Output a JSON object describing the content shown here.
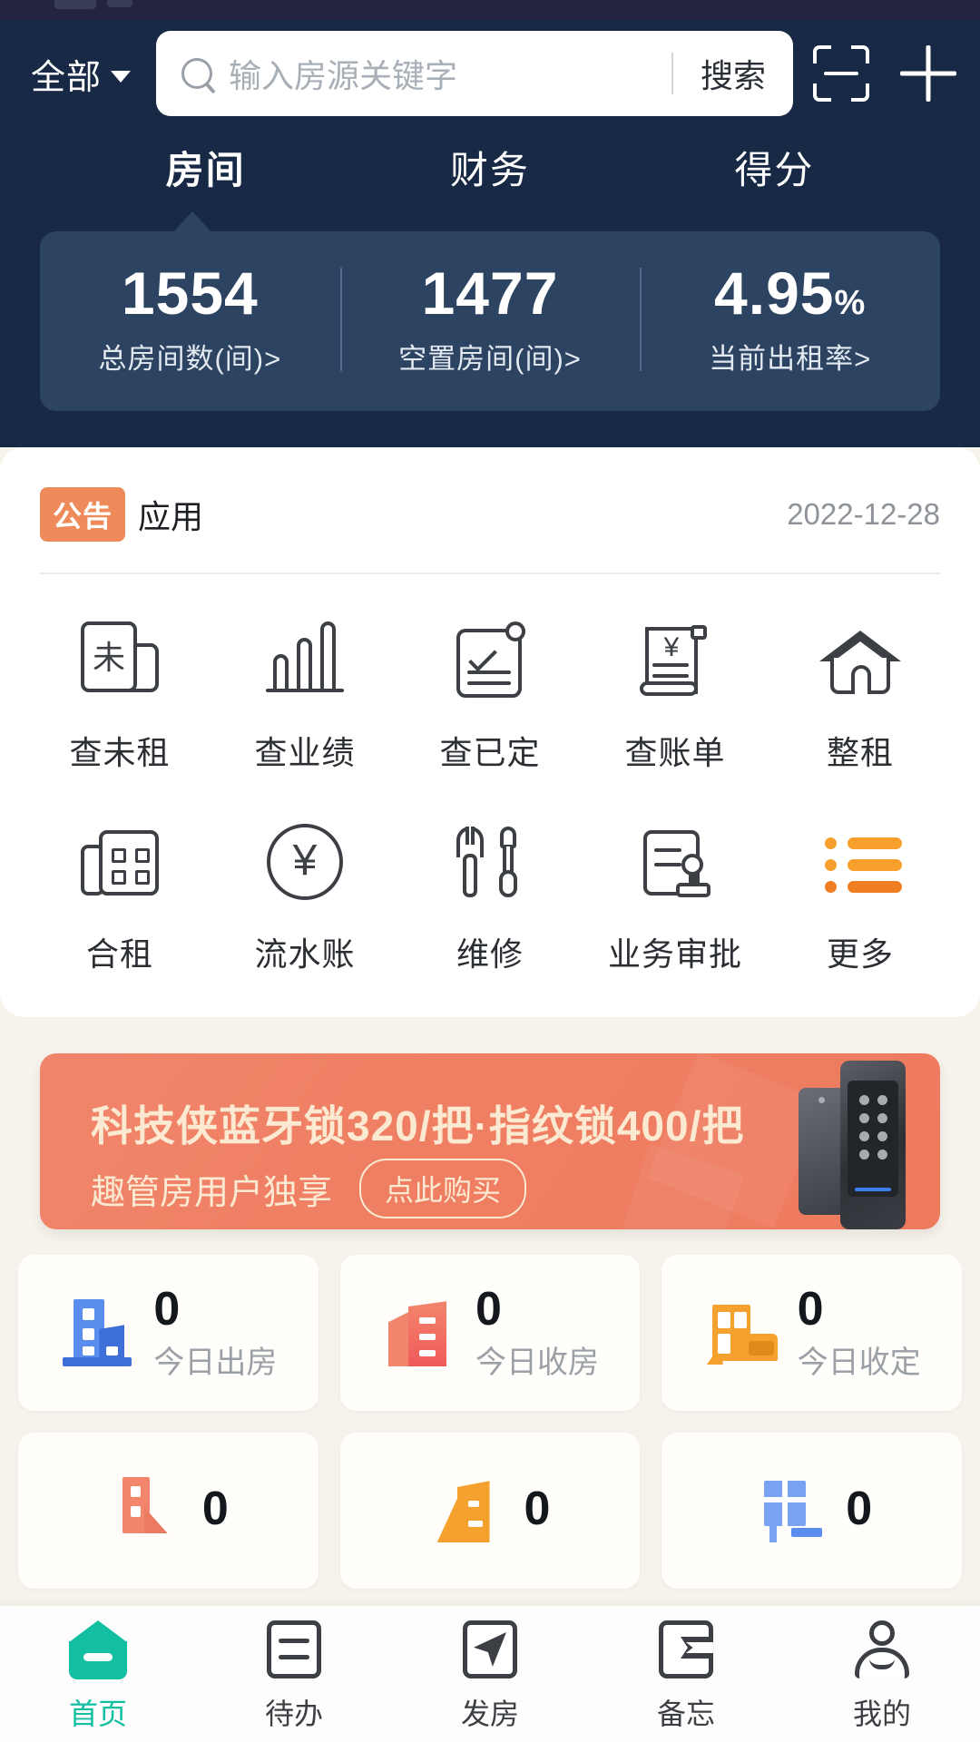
{
  "header": {
    "filter_label": "全部",
    "search_placeholder": "输入房源关键字",
    "search_value": "",
    "search_button": "搜索",
    "scan_icon": "scan-icon",
    "add_icon": "plus-icon"
  },
  "tabs": [
    {
      "label": "房间",
      "active": true
    },
    {
      "label": "财务",
      "active": false
    },
    {
      "label": "得分",
      "active": false
    }
  ],
  "stats": [
    {
      "value": "1554",
      "suffix": "",
      "label": "总房间数(间)>"
    },
    {
      "value": "1477",
      "suffix": "",
      "label": "空置房间(间)>"
    },
    {
      "value": "4.95",
      "suffix": "%",
      "label": "当前出租率>"
    }
  ],
  "notice": {
    "badge": "公告",
    "text": "应用",
    "date": "2022-12-28"
  },
  "apps": [
    {
      "label": "查未租",
      "icon": "unrented-doc-icon"
    },
    {
      "label": "查业绩",
      "icon": "bar-chart-icon"
    },
    {
      "label": "查已定",
      "icon": "clipboard-check-icon"
    },
    {
      "label": "查账单",
      "icon": "bill-scroll-icon"
    },
    {
      "label": "整租",
      "icon": "house-icon"
    },
    {
      "label": "合租",
      "icon": "shared-building-icon"
    },
    {
      "label": "流水账",
      "icon": "yen-circle-icon"
    },
    {
      "label": "维修",
      "icon": "wrench-screwdriver-icon"
    },
    {
      "label": "业务审批",
      "icon": "document-stamp-icon"
    },
    {
      "label": "更多",
      "icon": "more-list-icon"
    }
  ],
  "banner": {
    "title": "科技侠蓝牙锁320/把·指纹锁400/把",
    "subtitle": "趣管房用户独享",
    "button": "点此购买",
    "image": "smart-lock-image"
  },
  "cards": [
    {
      "value": "0",
      "label": "今日出房",
      "icon": "building-blue-icon"
    },
    {
      "value": "0",
      "label": "今日收房",
      "icon": "building-red-icon"
    },
    {
      "value": "0",
      "label": "今日收定",
      "icon": "building-sofa-orange-icon"
    },
    {
      "value": "0",
      "label": "",
      "icon": "building-red2-icon"
    },
    {
      "value": "0",
      "label": "",
      "icon": "building-orange2-icon"
    },
    {
      "value": "0",
      "label": "",
      "icon": "building-blue2-icon"
    }
  ],
  "bottom_nav": [
    {
      "label": "首页",
      "icon": "home-icon",
      "active": true
    },
    {
      "label": "待办",
      "icon": "todo-list-icon",
      "active": false
    },
    {
      "label": "发房",
      "icon": "publish-send-icon",
      "active": false
    },
    {
      "label": "备忘",
      "icon": "memo-flag-icon",
      "active": false
    },
    {
      "label": "我的",
      "icon": "user-profile-icon",
      "active": false
    }
  ],
  "colors": {
    "header_bg": "#172944",
    "stats_bg": "#2c4362",
    "accent_orange": "#ef8b5a",
    "accent_teal": "#12bfa0",
    "page_bg": "#f7f3ec"
  }
}
